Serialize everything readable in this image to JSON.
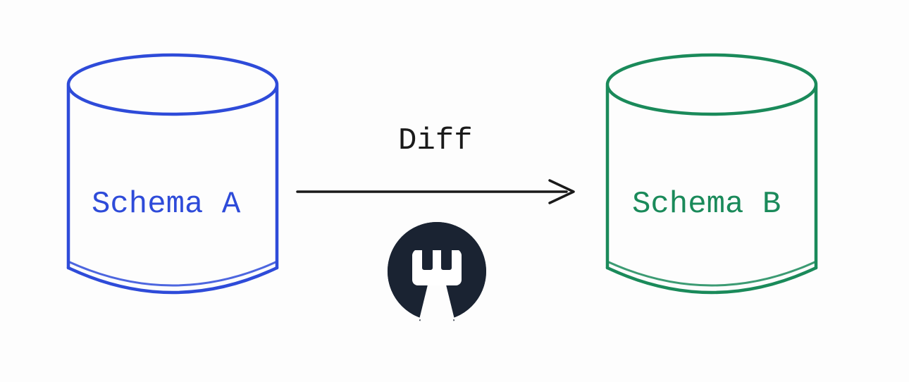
{
  "diagram": {
    "left_cylinder": {
      "label": "Schema A",
      "color": "#2e4bd9"
    },
    "right_cylinder": {
      "label": "Schema B",
      "color": "#1a8a5a"
    },
    "arrow": {
      "label": "Diff"
    },
    "logo": {
      "name": "bytebase-logo"
    }
  }
}
